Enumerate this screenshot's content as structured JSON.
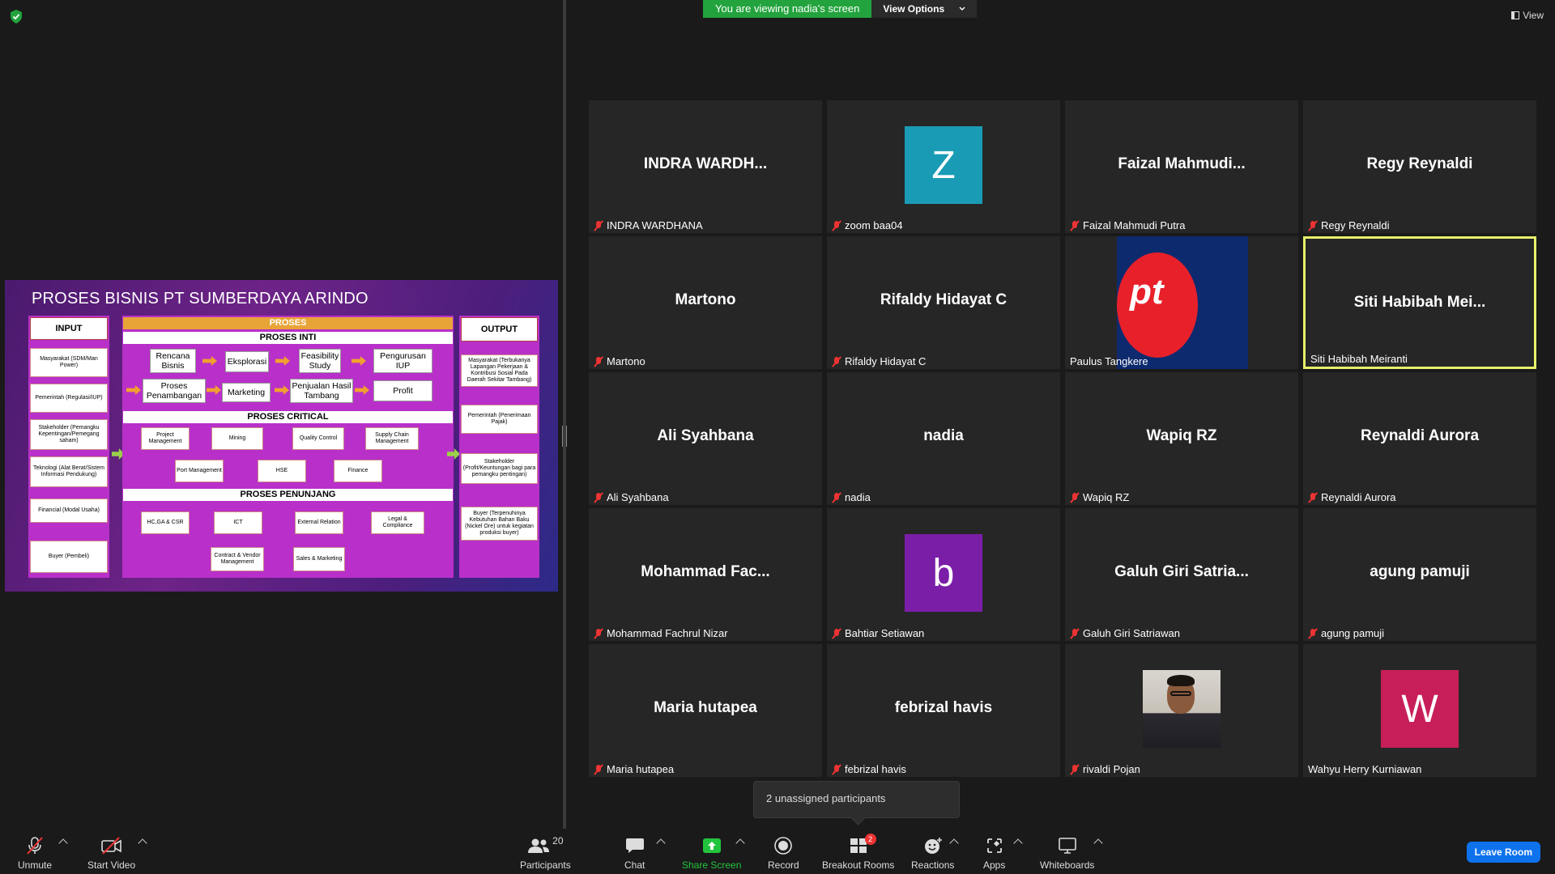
{
  "banner": {
    "viewing_text": "You are viewing nadia's screen",
    "view_options": "View Options",
    "view_label": "View"
  },
  "slide": {
    "title": "PROSES BISNIS PT SUMBERDAYA ARINDO",
    "input": {
      "header": "INPUT",
      "items": [
        "Masyarakat (SDM/Man Power)",
        "Pemerintah (Regulasi/IUP)",
        "Stakeholder (Pemangku Kepentingan/Pemegang saham)",
        "Teknologi (Alat Berat/Sistem Informasi Pendukung)",
        "Financial (Modal Usaha)",
        "Buyer (Pembeli)"
      ]
    },
    "proses": {
      "header": "PROSES",
      "inti": "PROSES INTI",
      "inti_row1": [
        "Rencana Bisnis",
        "Eksplorasi",
        "Feasibility Study",
        "Pengurusan IUP"
      ],
      "inti_row2": [
        "Proses Penambangan",
        "Marketing",
        "Penjualan Hasil Tambang",
        "Profit"
      ],
      "critical": "PROSES CRITICAL",
      "critical_items": [
        "Project Management",
        "Mining",
        "Quality Control",
        "Supply Chain Management",
        "Port Management",
        "HSE",
        "Finance"
      ],
      "penunjang": "PROSES PENUNJANG",
      "penunjang_items": [
        "HC,GA & CSR",
        "ICT",
        "External Relation",
        "Legal & Compliance",
        "Contract & Vendor Management",
        "Sales & Marketing"
      ]
    },
    "output": {
      "header": "OUTPUT",
      "items": [
        "Masyarakat (Terbukanya Lapangan Pekerjaan & Kontribusi Sosial Pada Daerah Sekitar Tambang)",
        "Pemerintah (Penerimaan Pajak)",
        "Stakeholder (Profit/Keuntungan bagi para pemangku pentingan)",
        "Buyer (Terpenuhinya Kebutuhan Bahan Baku (Nickel Ore) untuk kegiatan produksi buyer)"
      ]
    }
  },
  "participants": [
    {
      "display": "INDRA  WARDH...",
      "label": "INDRA WARDHANA",
      "muted": true
    },
    {
      "avatar_letter": "Z",
      "avatar_color": "#1a9bb5",
      "label": "zoom baa04",
      "muted": true
    },
    {
      "display": "Faizal  Mahmudi...",
      "label": "Faizal Mahmudi Putra",
      "muted": true
    },
    {
      "display": "Regy Reynaldi",
      "label": "Regy Reynaldi",
      "muted": true
    },
    {
      "display": "Martono",
      "label": "Martono",
      "muted": true
    },
    {
      "display": "Rifaldy Hidayat C",
      "label": "Rifaldy Hidayat C",
      "muted": true
    },
    {
      "logo": "pt",
      "label": "Paulus Tangkere",
      "muted": false
    },
    {
      "display": "Siti Habibah Mei...",
      "label": "Siti Habibah Meiranti",
      "muted": false,
      "active": true
    },
    {
      "display": "Ali Syahbana",
      "label": "Ali Syahbana",
      "muted": true
    },
    {
      "display": "nadia",
      "label": "nadia",
      "muted": true
    },
    {
      "display": "Wapiq RZ",
      "label": "Wapiq RZ",
      "muted": true
    },
    {
      "display": "Reynaldi Aurora",
      "label": "Reynaldi Aurora",
      "muted": true
    },
    {
      "display": "Mohammad  Fac...",
      "label": "Mohammad Fachrul Nizar",
      "muted": true
    },
    {
      "avatar_letter": "b",
      "avatar_color": "#7a1ea8",
      "label": "Bahtiar Setiawan",
      "muted": true
    },
    {
      "display": "Galuh Giri Satria...",
      "label": "Galuh Giri Satriawan",
      "muted": true
    },
    {
      "display": "agung pamuji",
      "label": "agung pamuji",
      "muted": true
    },
    {
      "display": "Maria hutapea",
      "label": "Maria hutapea",
      "muted": true
    },
    {
      "display": "febrizal havis",
      "label": "febrizal havis",
      "muted": true
    },
    {
      "photo": true,
      "label": "rivaldi Pojan",
      "muted": true
    },
    {
      "avatar_letter": "W",
      "avatar_color": "#c71e5a",
      "label": "Wahyu Herry Kurniawan",
      "muted": false
    }
  ],
  "tooltip": "2 unassigned participants",
  "toolbar": {
    "unmute": "Unmute",
    "start_video": "Start Video",
    "participants": "Participants",
    "participants_count": "20",
    "chat": "Chat",
    "share_screen": "Share Screen",
    "record": "Record",
    "breakout_rooms": "Breakout Rooms",
    "breakout_badge": "2",
    "reactions": "Reactions",
    "apps": "Apps",
    "whiteboards": "Whiteboards",
    "leave_room": "Leave Room"
  },
  "colors": {
    "accent_green": "#23a33d",
    "active_border": "#e6f06a",
    "leave_blue": "#0e72ed",
    "mute_red": "#e33333"
  }
}
